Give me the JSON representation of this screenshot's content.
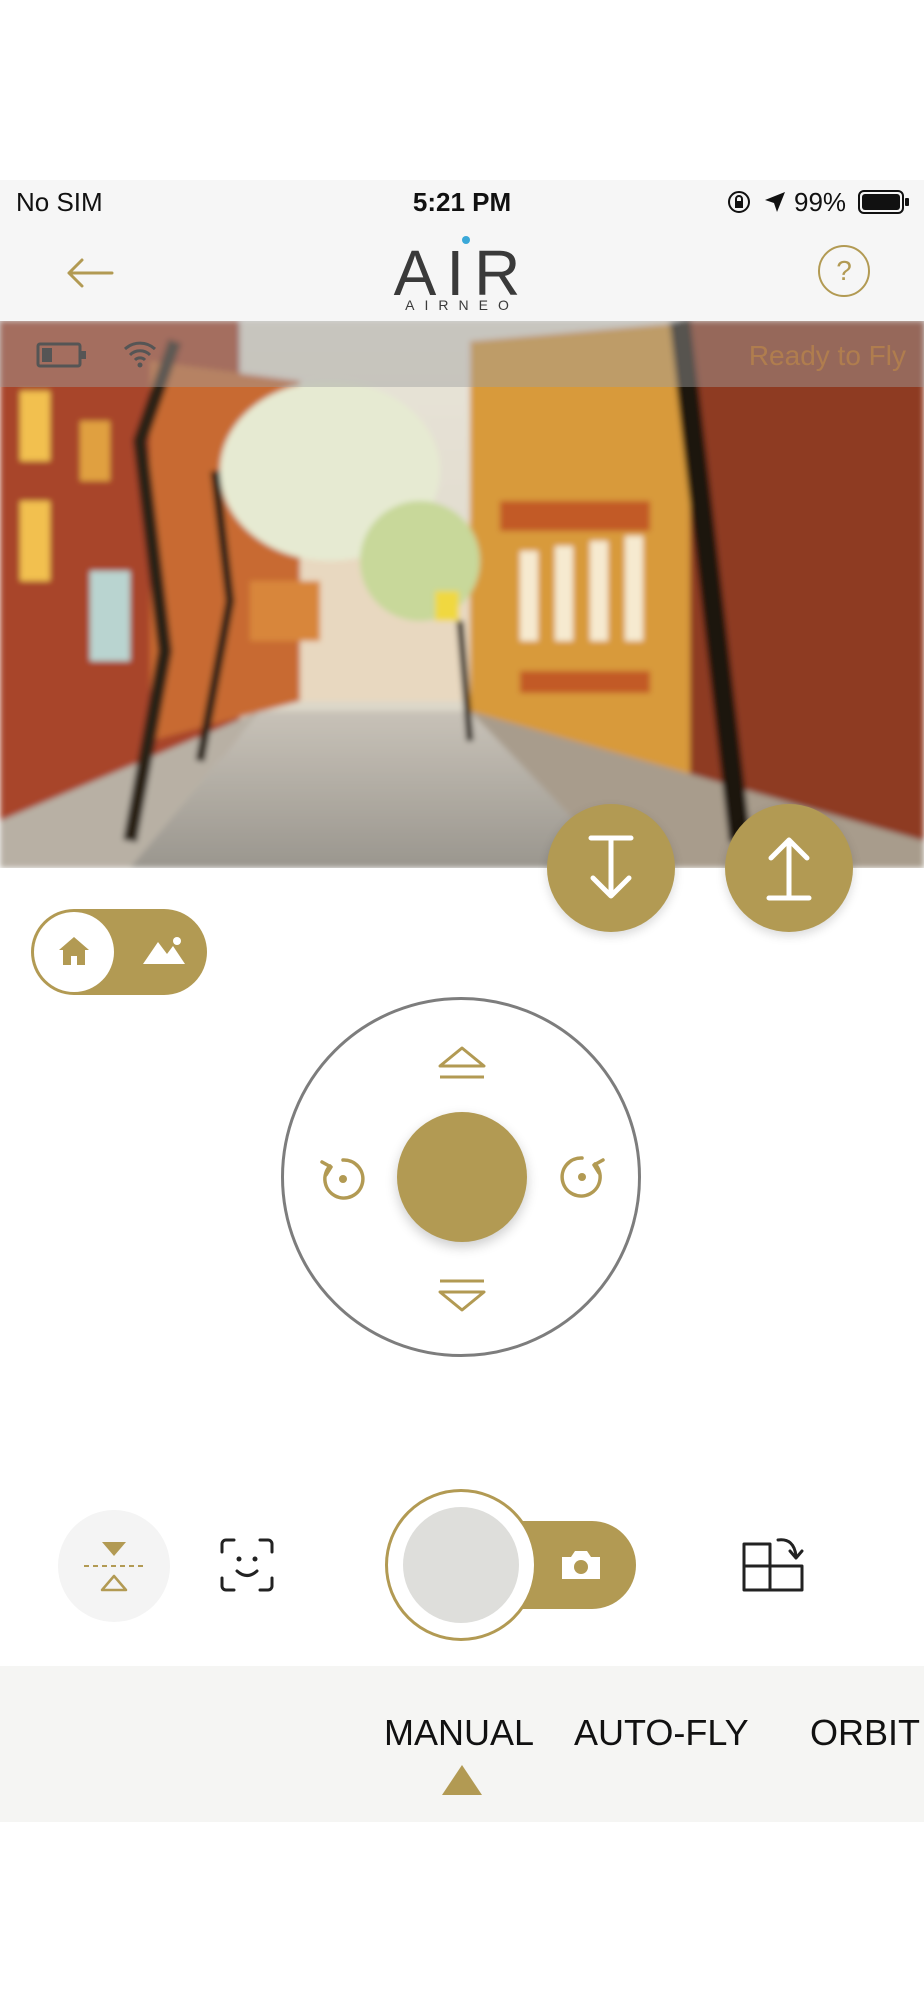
{
  "status_bar": {
    "carrier": "No SIM",
    "time": "5:21 PM",
    "battery_percent": "99%"
  },
  "nav": {
    "logo_main": "AIR",
    "logo_sub": "AIRNEO",
    "help_label": "?"
  },
  "camera": {
    "status_text": "Ready to Fly"
  },
  "bottom_tabs": {
    "items": [
      {
        "label": "MANUAL",
        "selected": true
      },
      {
        "label": "AUTO-FLY",
        "selected": false
      },
      {
        "label": "ORBIT",
        "selected": false
      }
    ]
  },
  "colors": {
    "accent": "#b29a53",
    "bar_bg": "#f6f6f6"
  }
}
